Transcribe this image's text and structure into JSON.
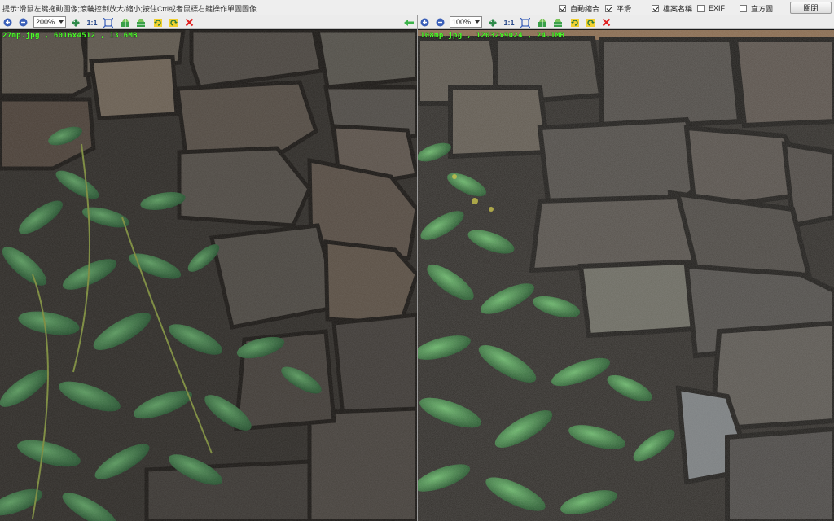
{
  "hint_text": "提示:滑鼠左鍵拖動圖像;滾輪控制放大/縮小;按住Ctrl或者鼠標右鍵操作單圖圖像",
  "options": [
    {
      "label": "自動縮合",
      "checked": true
    },
    {
      "label": "平滑",
      "checked": true
    },
    {
      "label": "檔案名稱",
      "checked": true
    },
    {
      "label": "EXIF",
      "checked": false
    },
    {
      "label": "直方圖",
      "checked": false
    }
  ],
  "close_label": "關閉",
  "left_pane": {
    "zoom": "200%",
    "one_to_one": "1:1",
    "image_label": "27mp.jpg , 6016x4512 , 13.6MB"
  },
  "right_pane": {
    "zoom": "100%",
    "one_to_one": "1:1",
    "image_label": "108mp.jpg , 12032x9024 , 24.1MB"
  },
  "icons": [
    "zoom-in-icon",
    "zoom-out-icon",
    "fit-window-icon",
    "actual-size-icon",
    "fit-icon",
    "flip-horizontal-icon",
    "flip-vertical-icon",
    "rotate-left-icon",
    "rotate-right-icon",
    "close-image-icon",
    "sync-arrow-icon"
  ],
  "colors": {
    "label_green": "#4cff2a",
    "close_x": "#e02020",
    "toolbar_bg": "#ececec"
  }
}
